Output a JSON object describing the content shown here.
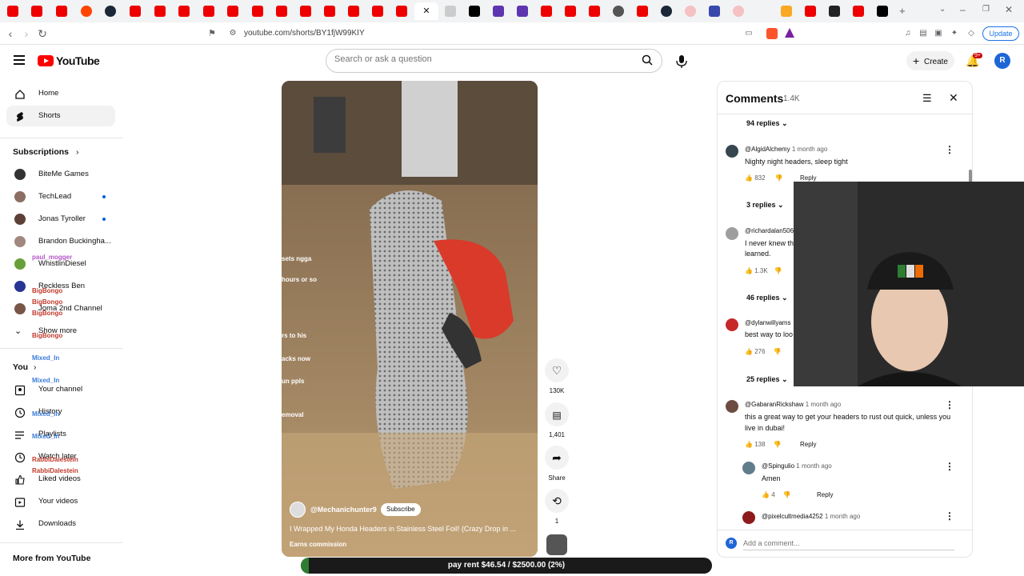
{
  "browser": {
    "url": "youtube.com/shorts/BY1fjW99KIY",
    "update_label": "Update",
    "notifications_badge": "9+"
  },
  "header": {
    "logo_text": "YouTube",
    "search_placeholder": "Search or ask a question",
    "create_label": "Create",
    "avatar_letter": "R"
  },
  "sidebar": {
    "home": "Home",
    "shorts": "Shorts",
    "subscriptions_heading": "Subscriptions",
    "channels": [
      "BiteMe Games",
      "TechLead",
      "Jonas Tyroller",
      "Brandon Buckingha...",
      "WhistlinDiesel",
      "Reckless Ben",
      "Joma 2nd Channel"
    ],
    "show_more": "Show more",
    "you_heading": "You",
    "you_items": [
      "Your channel",
      "History",
      "Playlists",
      "Watch later",
      "Liked videos",
      "Your videos",
      "Downloads"
    ],
    "more_heading": "More from YouTube"
  },
  "chat_overlay": {
    "names": [
      "paul_mogger",
      "BigBongo",
      "BigBongo",
      "BigBongo",
      "BigBongo",
      "Mixed_In",
      "Mixed_In",
      "Mixed_In",
      "Mixed_In",
      "RabbiDalestein",
      "RabbiDalestein"
    ]
  },
  "video": {
    "overlay_lines": [
      "sets ngga",
      "hours or so",
      "rs to his",
      "acks now",
      "un ppls",
      "emoval"
    ],
    "channel": "@Mechanichunter9",
    "subscribe_label": "Subscribe",
    "title": "I Wrapped My Honda Headers in Stainless Steel Foil! (Crazy Drop in ...",
    "earns": "Earns commission",
    "likes": "130K",
    "comments_count": "1,401",
    "share_label": "Share",
    "remix_count": "1"
  },
  "comments": {
    "title": "Comments",
    "count": "1.4K",
    "add_placeholder": "Add a comment...",
    "add_avatar": "R",
    "items": [
      {
        "replies": "94 replies"
      },
      {
        "name": "@AlgidAlchemy",
        "time": "1 month ago",
        "text": "Nighty night headers, sleep tight",
        "likes": "832",
        "reply": "Reply",
        "replies": "3 replies"
      },
      {
        "name": "@richardalan506",
        "text_lines": [
          "I never knew th",
          "learned."
        ],
        "likes": "1.3K",
        "replies": "46 replies"
      },
      {
        "name": "@dylanwillyams",
        "text": "best way to loo",
        "likes": "276",
        "replies": "25 replies"
      },
      {
        "name": "@GabaranRickshaw",
        "time": "1 month ago",
        "text_lines": [
          "this a great way to get your headers to rust out quick, unless you",
          "live in dubai!"
        ],
        "likes": "138",
        "reply": "Reply"
      },
      {
        "name": "@Spingulio",
        "time": "1 month ago",
        "text": "Amen",
        "likes": "4",
        "reply": "Reply"
      },
      {
        "name": "@pixelcultmedia4252",
        "time": "1 month ago"
      }
    ]
  },
  "donation": {
    "text": "pay rent $46.54 / $2500.00 (2%)",
    "progress_fraction": 0.02
  }
}
